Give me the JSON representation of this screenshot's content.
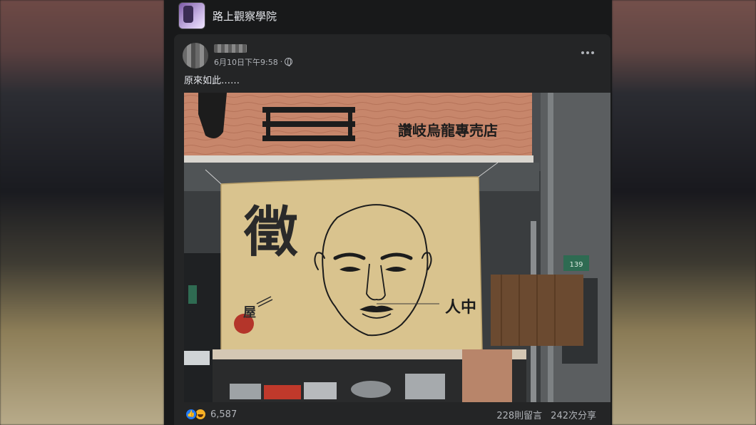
{
  "group": {
    "name": "路上觀察學院",
    "avatar_icon": "group-avatar-image"
  },
  "post": {
    "timestamp": "6月10日下午9:58",
    "separator": "·",
    "privacy_icon": "globe-icon",
    "text": "原來如此……",
    "more_icon": "more-options-icon"
  },
  "photo": {
    "sign_text": "讚岐烏龍專売店",
    "banner_big_char": "徵",
    "banner_label": "人中",
    "banner_small_char": "屋",
    "door_number": "139"
  },
  "footer": {
    "reaction_count": "6,587",
    "comments": "228則留言",
    "shares": "242次分享",
    "colors": {
      "like": "#2078f4",
      "haha": "#f7b125"
    }
  }
}
